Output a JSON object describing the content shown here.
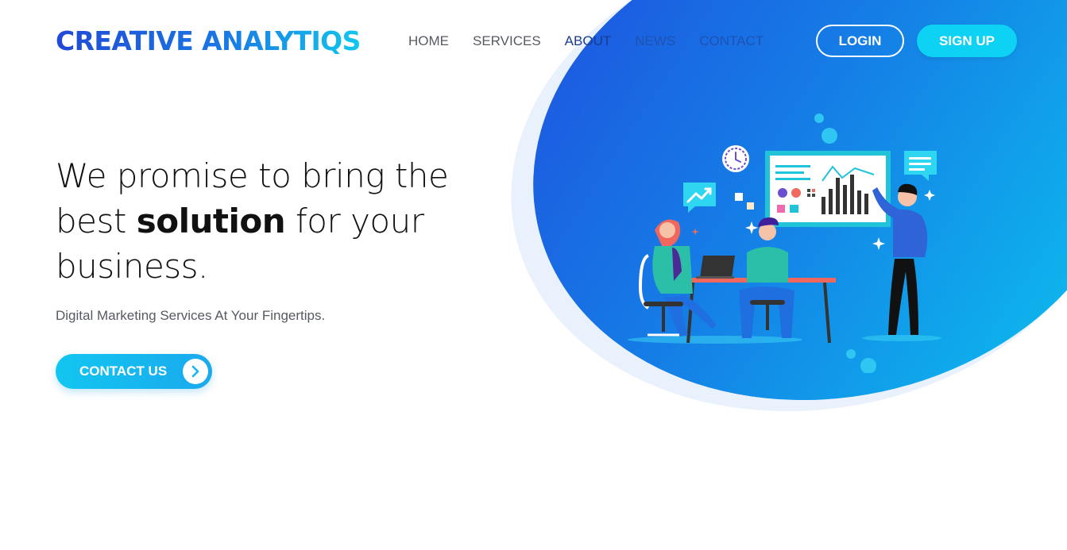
{
  "brand": {
    "name": "CREATIVE ANALYTIQS"
  },
  "nav": {
    "items": [
      {
        "label": "HOME"
      },
      {
        "label": "SERVICES"
      },
      {
        "label": "ABOUT"
      },
      {
        "label": "NEWS"
      },
      {
        "label": "CONTACT"
      }
    ]
  },
  "auth": {
    "login_label": "LOGIN",
    "signup_label": "SIGN UP"
  },
  "hero": {
    "title_part1": "We promise to bring the best",
    "title_bold": "solution",
    "title_part2": "for your business.",
    "subtitle": "Digital Marketing Services At Your Fingertips.",
    "cta_label": "CONTACT US"
  },
  "icons": {
    "cta": "chevron-right-icon",
    "illustration": "team-analytics-illustration"
  },
  "colors": {
    "brand_blue": "#2149d6",
    "brand_cyan": "#11c7ee",
    "accent": "#0ed2f3",
    "blob_start": "#1f4fdf",
    "blob_end": "#0bc6ef",
    "text_dark": "#111111",
    "text_muted": "#555a63"
  }
}
